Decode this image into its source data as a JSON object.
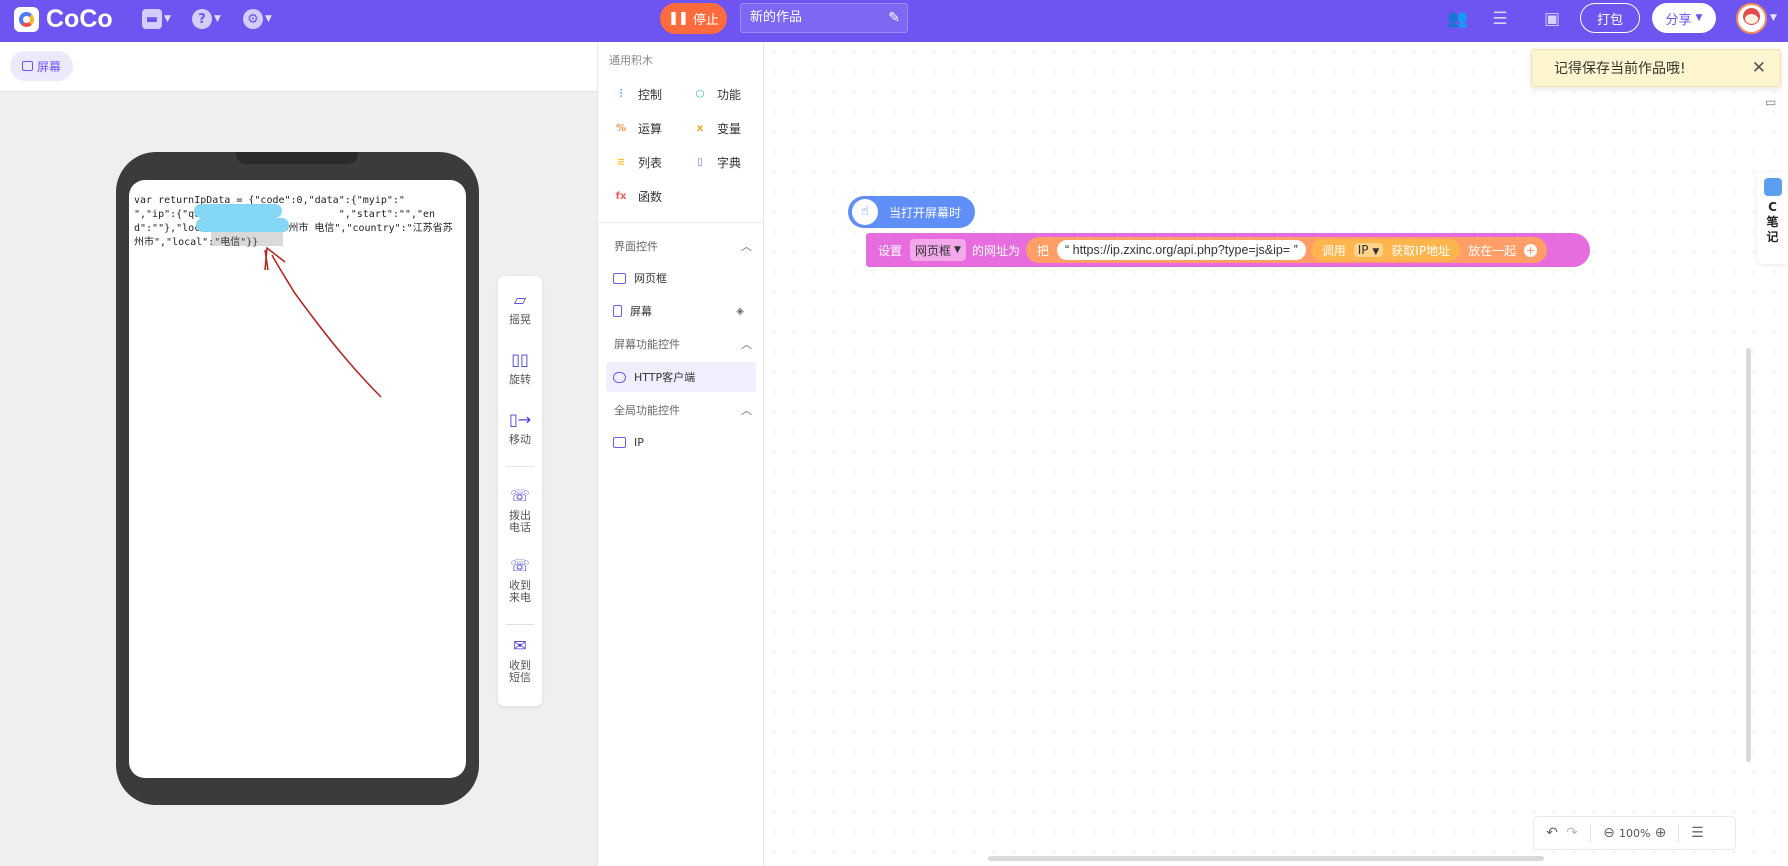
{
  "app": {
    "logo_text": "CoCo",
    "stop_label": "停止",
    "project_title": "新的作品",
    "pack_label": "打包",
    "share_label": "分享"
  },
  "preview": {
    "screen_tab_label": "屏幕",
    "code_text": "var returnIpData = {\"code\":0,\"data\":{\"myip\":\"                 \",\"ip\":{\"query\":\"                 \",\"start\":\"\",\"end\":\"\"},\"location\":\"江苏省苏州市 电信\",\"country\":\"江苏省苏州市\",\"local\":\"电信\"}}",
    "tools": [
      {
        "label": "摇晃",
        "icon": "shake-icon"
      },
      {
        "label": "旋转",
        "icon": "rotate-icon"
      },
      {
        "label": "移动",
        "icon": "move-icon"
      },
      {
        "label": "拨出电话",
        "icon": "phone-out-icon"
      },
      {
        "label": "收到来电",
        "icon": "phone-in-icon"
      },
      {
        "label": "收到短信",
        "icon": "sms-icon"
      }
    ]
  },
  "palette": {
    "general_title": "通用积木",
    "categories": [
      {
        "label": "控制",
        "color": "#4aa3f0",
        "glyph": "⫶"
      },
      {
        "label": "功能",
        "color": "#28b6c8",
        "glyph": "⬡"
      },
      {
        "label": "运算",
        "color": "#ff8c42",
        "glyph": "%"
      },
      {
        "label": "变量",
        "color": "#f5a623",
        "glyph": "x"
      },
      {
        "label": "列表",
        "color": "#f5c02a",
        "glyph": "≡"
      },
      {
        "label": "字典",
        "color": "#8e6cf2",
        "glyph": "▯"
      },
      {
        "label": "函数",
        "color": "#f25c5c",
        "glyph": "fx"
      }
    ],
    "ui_section": "界面控件",
    "ui_items": [
      "网页框",
      "屏幕"
    ],
    "screen_section": "屏幕功能控件",
    "screen_items": [
      "HTTP客户端"
    ],
    "global_section": "全局功能控件",
    "global_items": [
      "IP"
    ]
  },
  "canvas": {
    "toast_text": "记得保存当前作品哦!",
    "hat_label": "当打开屏幕时",
    "block": {
      "set_label": "设置",
      "target_dropdown": "网页框",
      "property_label": "的网址为",
      "join_label": "把",
      "url_text": "“ https://ip.zxinc.org/api.php?type=js&ip= ”",
      "call_label": "调用",
      "call_dropdown": "IP",
      "call_method": "获取IP地址",
      "join_suffix": "放在一起"
    },
    "zoom_level": "100%",
    "note_label": [
      "C",
      "笔",
      "记"
    ]
  }
}
